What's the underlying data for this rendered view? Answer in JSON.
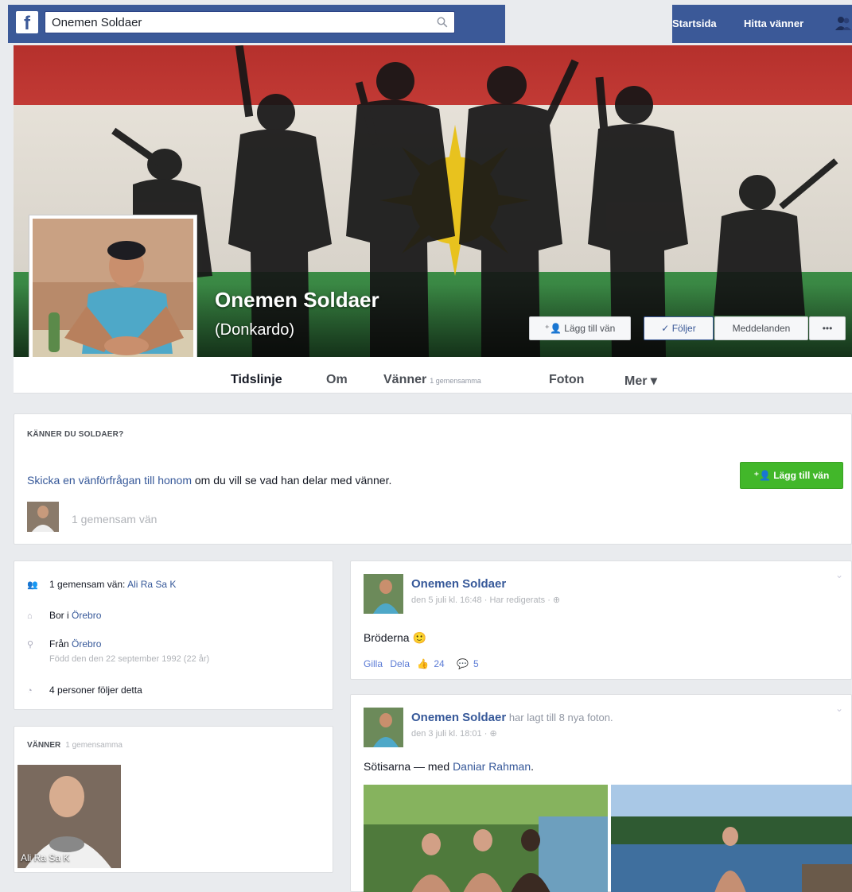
{
  "topbar": {
    "logo": "f",
    "search_value": "Onemen Soldaer",
    "nav_home": "Startsida",
    "nav_find_friends": "Hitta vänner"
  },
  "profile": {
    "name": "Onemen Soldaer",
    "alt_name": "(Donkardo)"
  },
  "cover_buttons": {
    "add_friend": "Lägg till vän",
    "following": "Följer",
    "message": "Meddelanden",
    "more": "•••"
  },
  "tabs": {
    "timeline": "Tidslinje",
    "about": "Om",
    "friends": "Vänner",
    "friends_sub": "1 gemensamma",
    "photos": "Foton",
    "more": "Mer ▾"
  },
  "know_box": {
    "title": "KÄNNER DU SOLDAER?",
    "link_text": "Skicka en vänförfrågan till honom",
    "rest_text": " om du vill se vad han delar med vänner.",
    "add_button": "Lägg till vän",
    "mutual": "1 gemensam vän"
  },
  "intro": {
    "mutual_label": "1 gemensam vän: ",
    "mutual_name": "Ali Ra Sa K",
    "lives_label": "Bor i ",
    "lives_city": "Örebro",
    "from_label": "Från ",
    "from_city": "Örebro",
    "born": "Född den den 22 september 1992 (22 år)",
    "followers": "4 personer följer detta"
  },
  "friends_box": {
    "title": "VÄNNER",
    "sub": "1 gemensamma",
    "friend_name": "Ali Ra Sa K"
  },
  "posts": [
    {
      "author": "Onemen Soldaer",
      "time": "den 5 juli kl. 16:48 · Har redigerats · ⊕",
      "text": "Bröderna 🙂",
      "like": "Gilla",
      "share": "Dela",
      "likes_count": "24",
      "comments_count": "5"
    },
    {
      "author": "Onemen Soldaer",
      "action": " har lagt till 8 nya foton.",
      "time": "den 3 juli kl. 18:01 · ⊕",
      "text_prefix": "Sötisarna — med ",
      "tagged": "Daniar Rahman",
      "text_suffix": "."
    }
  ],
  "colors": {
    "facebook_blue": "#3b5998",
    "link_blue": "#365899",
    "add_friend_green": "#42b72a"
  }
}
